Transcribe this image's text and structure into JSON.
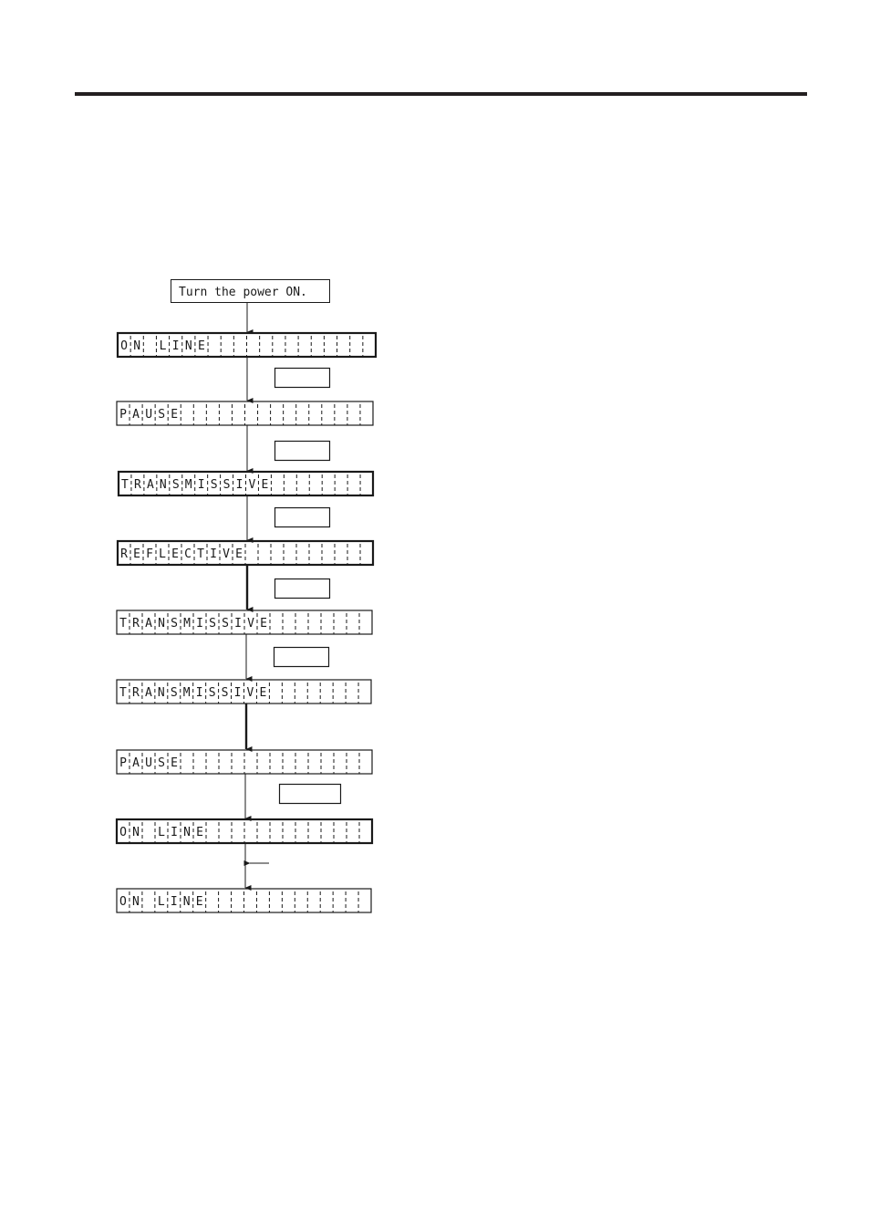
{
  "page": {
    "header_rule": true
  },
  "diagram": {
    "start_box": {
      "label": "Turn the power ON."
    },
    "lcd_cells": 20,
    "steps": [
      {
        "display": "ON LINE",
        "border": "thick"
      },
      {
        "display": "PAUSE",
        "border": "thin"
      },
      {
        "display": "TRANSMISSIVE",
        "border": "thick"
      },
      {
        "display": "REFLECTIVE",
        "border": "thick"
      },
      {
        "display": "TRANSMISSIVE",
        "border": "thin"
      },
      {
        "display": "TRANSMISSIVE",
        "border": "thin"
      },
      {
        "display": "PAUSE",
        "border": "thin"
      },
      {
        "display": "ON LINE",
        "border": "thick"
      },
      {
        "display": "ON LINE",
        "border": "thin"
      }
    ],
    "transitions": [
      {
        "from": 0,
        "to": 1,
        "key_box": true,
        "key_label": "",
        "line": "thin"
      },
      {
        "from": 1,
        "to": 2,
        "key_box": true,
        "key_label": "",
        "line": "thin"
      },
      {
        "from": 2,
        "to": 3,
        "key_box": true,
        "key_label": "",
        "line": "thin"
      },
      {
        "from": 3,
        "to": 4,
        "key_box": true,
        "key_label": "",
        "line": "thick"
      },
      {
        "from": 4,
        "to": 5,
        "key_box": true,
        "key_label": "",
        "line": "thin"
      },
      {
        "from": 5,
        "to": 6,
        "key_box": false,
        "key_label": "",
        "line": "thick"
      },
      {
        "from": 6,
        "to": 7,
        "key_box": true,
        "key_label": "",
        "line": "thin",
        "wide": true
      },
      {
        "from": 7,
        "to": 8,
        "key_box": false,
        "key_label": "",
        "line": "thin",
        "side_arrow": "left"
      }
    ],
    "colors": {
      "ink": "#1a1a1a",
      "rule": "#231f20",
      "background": "#ffffff"
    }
  }
}
